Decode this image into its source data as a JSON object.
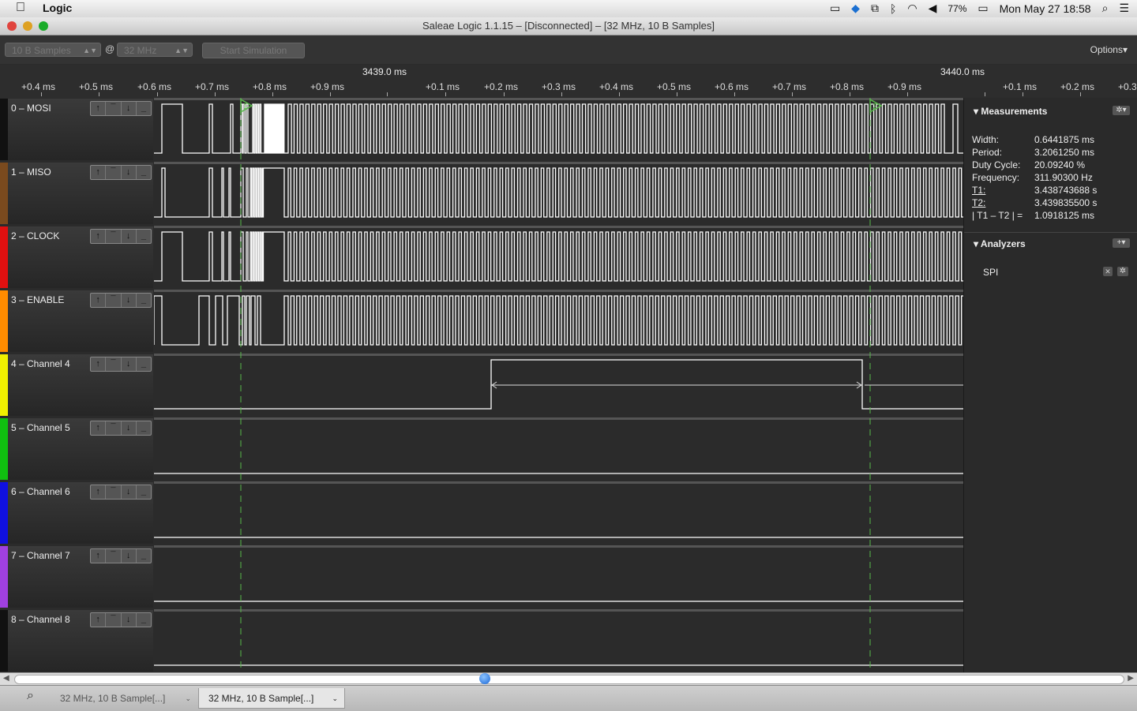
{
  "menubar": {
    "apple_icon": "apple-logo-icon",
    "app_name": "Logic",
    "battery": "77%",
    "datetime": "Mon May 27  18:58"
  },
  "window": {
    "title": "Saleae Logic 1.1.15 – [Disconnected] – [32 MHz, 10 B Samples]"
  },
  "toolbar": {
    "samples": "10 B Samples",
    "at": "@",
    "rate": "32 MHz",
    "start_label": "Start Simulation",
    "options_label": "Options▾"
  },
  "timeline": {
    "major_labels": [
      "3439.0 ms",
      "3440.0 ms"
    ],
    "ticks": [
      "+0.4 ms",
      "+0.5 ms",
      "+0.6 ms",
      "+0.7 ms",
      "+0.8 ms",
      "+0.9 ms",
      "+0.1 ms",
      "+0.2 ms",
      "+0.3 ms",
      "+0.4 ms",
      "+0.5 ms",
      "+0.6 ms",
      "+0.7 ms",
      "+0.8 ms",
      "+0.9 ms",
      "+0.1 ms",
      "+0.2 ms",
      "+0.3"
    ]
  },
  "channels": [
    {
      "name": "0 – MOSI",
      "color": "#111111"
    },
    {
      "name": "1 – MISO",
      "color": "#7a4a1e"
    },
    {
      "name": "2 – CLOCK",
      "color": "#e01010"
    },
    {
      "name": "3 – ENABLE",
      "color": "#ff8c00"
    },
    {
      "name": "4 – Channel 4",
      "color": "#f0f000"
    },
    {
      "name": "5 – Channel 5",
      "color": "#10c010"
    },
    {
      "name": "6 – Channel 6",
      "color": "#1010e0"
    },
    {
      "name": "7 – Channel 7",
      "color": "#a040e0"
    },
    {
      "name": "8 – Channel 8",
      "color": "#111111"
    }
  ],
  "markers": {
    "t1": "1",
    "t2": "2"
  },
  "measurements": {
    "header": "Measurements",
    "rows": [
      {
        "label": "Width:",
        "value": "0.6441875 ms"
      },
      {
        "label": "Period:",
        "value": "3.2061250 ms"
      },
      {
        "label": "Duty Cycle:",
        "value": "20.09240 %"
      },
      {
        "label": "Frequency:",
        "value": "311.90300 Hz"
      },
      {
        "label": "T1:",
        "value": "3.438743688 s"
      },
      {
        "label": "T2:",
        "value": "3.439835500 s"
      },
      {
        "label": "| T1 – T2 | =",
        "value": "1.0918125 ms"
      }
    ]
  },
  "analyzers": {
    "header": "Analyzers",
    "items": [
      "SPI"
    ]
  },
  "tabs": [
    {
      "label": "32 MHz, 10 B Sample[...]"
    },
    {
      "label": "32 MHz, 10 B Sample[...]"
    }
  ]
}
